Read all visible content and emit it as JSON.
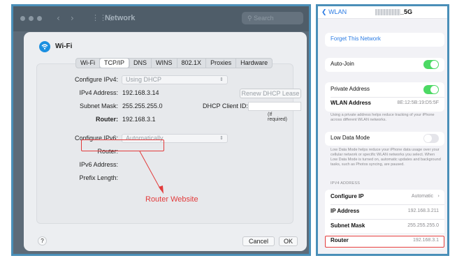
{
  "mac": {
    "window_title": "Network",
    "search_placeholder": "Search",
    "sheet_title": "Wi-Fi",
    "tabs": [
      "Wi-Fi",
      "TCP/IP",
      "DNS",
      "WINS",
      "802.1X",
      "Proxies",
      "Hardware"
    ],
    "active_tab": "TCP/IP",
    "configure_ipv4_label": "Configure IPv4:",
    "configure_ipv4_value": "Using DHCP",
    "ipv4_address_label": "IPv4 Address:",
    "ipv4_address_value": "192.168.3.14",
    "renew_button": "Renew DHCP Lease",
    "subnet_mask_label": "Subnet Mask:",
    "subnet_mask_value": "255.255.255.0",
    "dhcp_client_id_label": "DHCP Client ID:",
    "dhcp_client_id_hint": "(If required)",
    "router_label": "Router:",
    "router_value": "192.168.3.1",
    "configure_ipv6_label": "Configure IPv6:",
    "configure_ipv6_value": "Automatically",
    "router6_label": "Router:",
    "ipv6_address_label": "IPv6 Address:",
    "prefix_length_label": "Prefix Length:",
    "annotation": "Router Website",
    "help_label": "?",
    "cancel_button": "Cancel",
    "ok_button": "OK"
  },
  "ios": {
    "back_label": "WLAN",
    "ssid_suffix": "_5G",
    "forget": "Forget This Network",
    "auto_join": "Auto-Join",
    "auto_join_on": true,
    "private_address": "Private Address",
    "private_address_on": true,
    "wlan_address_label": "WLAN Address",
    "wlan_address_value": "8E:12:5B:19:D5:5F",
    "private_note": "Using a private address helps reduce tracking of your iPhone across different WLAN networks.",
    "low_data_mode": "Low Data Mode",
    "low_data_mode_on": false,
    "low_data_note": "Low Data Mode helps reduce your iPhone data usage over your cellular network or specific WLAN networks you select. When Low Data Mode is turned on, automatic updates and background tasks, such as Photos syncing, are paused.",
    "ipv4_section": "IPV4 ADDRESS",
    "configure_ip_label": "Configure IP",
    "configure_ip_value": "Automatic",
    "ip_address_label": "IP Address",
    "ip_address_value": "192.168.3.211",
    "subnet_mask_label": "Subnet Mask",
    "subnet_mask_value": "255.255.255.0",
    "router_label": "Router",
    "router_value": "192.168.3.1"
  },
  "colors": {
    "highlight": "#e23b3b",
    "frame": "#4a8fb8",
    "ios_link": "#2a7be4",
    "toggle_on": "#4cd964"
  },
  "icons": [
    "chevron-left-icon",
    "chevron-right-icon",
    "grid-icon",
    "search-icon",
    "wifi-icon",
    "popup-chevron-icon"
  ]
}
